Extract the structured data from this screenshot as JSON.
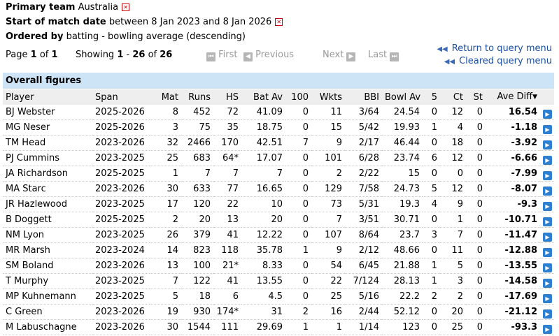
{
  "filters": [
    {
      "label": "Primary team",
      "value": "Australia"
    },
    {
      "label": "Start of match date",
      "value": "between 8 Jan 2023 and 8 Jan 2026"
    },
    {
      "label": "Ordered by",
      "value": "batting - bowling average (descending)"
    }
  ],
  "pager": {
    "page_word": "Page",
    "page": "1",
    "of_word": "of",
    "pages": "1",
    "showing_word": "Showing",
    "from": "1",
    "dash": "-",
    "to": "26",
    "of_word2": "of",
    "total": "26",
    "first": "First",
    "previous": "Previous",
    "next": "Next",
    "last": "Last"
  },
  "links": {
    "return": "Return to query menu",
    "cleared": "Cleared query menu"
  },
  "section_title": "Overall figures",
  "columns": [
    "Player",
    "Span",
    "Mat",
    "Runs",
    "HS",
    "Bat Av",
    "100",
    "Wkts",
    "BBI",
    "Bowl Av",
    "5",
    "Ct",
    "St",
    "Ave Diff"
  ],
  "rows": [
    [
      "BJ Webster",
      "2025-2026",
      "8",
      "452",
      "72",
      "41.09",
      "0",
      "11",
      "3/64",
      "24.54",
      "0",
      "12",
      "0",
      "16.54"
    ],
    [
      "MG Neser",
      "2025-2026",
      "3",
      "75",
      "35",
      "18.75",
      "0",
      "15",
      "5/42",
      "19.93",
      "1",
      "4",
      "0",
      "-1.18"
    ],
    [
      "TM Head",
      "2023-2026",
      "32",
      "2466",
      "170",
      "42.51",
      "7",
      "9",
      "2/17",
      "46.44",
      "0",
      "18",
      "0",
      "-3.92"
    ],
    [
      "PJ Cummins",
      "2023-2025",
      "25",
      "683",
      "64*",
      "17.07",
      "0",
      "101",
      "6/28",
      "23.74",
      "6",
      "12",
      "0",
      "-6.66"
    ],
    [
      "JA Richardson",
      "2025-2025",
      "1",
      "7",
      "7",
      "7",
      "0",
      "2",
      "2/22",
      "15",
      "0",
      "0",
      "0",
      "-7.99"
    ],
    [
      "MA Starc",
      "2023-2026",
      "30",
      "633",
      "77",
      "16.65",
      "0",
      "129",
      "7/58",
      "24.73",
      "5",
      "12",
      "0",
      "-8.07"
    ],
    [
      "JR Hazlewood",
      "2023-2025",
      "17",
      "120",
      "22",
      "10",
      "0",
      "73",
      "5/31",
      "19.3",
      "4",
      "9",
      "0",
      "-9.3"
    ],
    [
      "B Doggett",
      "2025-2025",
      "2",
      "20",
      "13",
      "20",
      "0",
      "7",
      "3/51",
      "30.71",
      "0",
      "1",
      "0",
      "-10.71"
    ],
    [
      "NM Lyon",
      "2023-2025",
      "26",
      "379",
      "41",
      "12.22",
      "0",
      "107",
      "8/64",
      "23.7",
      "3",
      "7",
      "0",
      "-11.47"
    ],
    [
      "MR Marsh",
      "2023-2024",
      "14",
      "823",
      "118",
      "35.78",
      "1",
      "9",
      "2/12",
      "48.66",
      "0",
      "11",
      "0",
      "-12.88"
    ],
    [
      "SM Boland",
      "2023-2026",
      "13",
      "100",
      "21*",
      "8.33",
      "0",
      "54",
      "6/45",
      "21.88",
      "1",
      "5",
      "0",
      "-13.55"
    ],
    [
      "T Murphy",
      "2023-2025",
      "7",
      "122",
      "41",
      "13.55",
      "0",
      "22",
      "7/124",
      "28.13",
      "1",
      "3",
      "0",
      "-14.58"
    ],
    [
      "MP Kuhnemann",
      "2023-2025",
      "5",
      "18",
      "6",
      "4.5",
      "0",
      "25",
      "5/16",
      "22.2",
      "2",
      "2",
      "0",
      "-17.69"
    ],
    [
      "C Green",
      "2023-2026",
      "19",
      "930",
      "174*",
      "31",
      "2",
      "16",
      "2/44",
      "52.12",
      "0",
      "20",
      "0",
      "-21.12"
    ],
    [
      "M Labuschagne",
      "2023-2026",
      "30",
      "1544",
      "111",
      "29.69",
      "1",
      "1",
      "1/14",
      "123",
      "0",
      "25",
      "0",
      "-93.3"
    ]
  ],
  "icons": {
    "remove": "remove-filter-icon",
    "row_link": "row-play-icon",
    "sort": "sort-desc-icon"
  },
  "colors": {
    "header_bg": "#cde4f7",
    "link": "#1a4fa3",
    "play": "#2f7fd0",
    "remove": "#cc0000"
  }
}
